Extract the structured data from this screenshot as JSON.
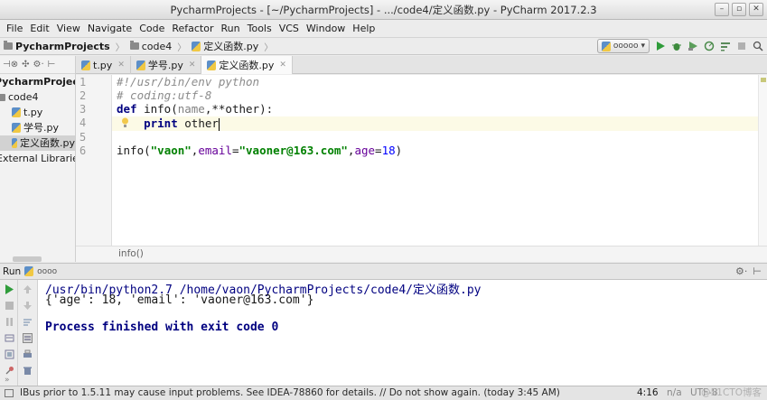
{
  "window": {
    "title": "PycharmProjects - [~/PycharmProjects] - .../code4/定义函数.py - PyCharm 2017.2.3"
  },
  "menu": [
    "File",
    "Edit",
    "View",
    "Navigate",
    "Code",
    "Refactor",
    "Run",
    "Tools",
    "VCS",
    "Window",
    "Help"
  ],
  "breadcrumb": {
    "project": "PycharmProjects",
    "folder": "code4",
    "file": "定义函数.py"
  },
  "run_config": {
    "label": "ooooo"
  },
  "sidebar": {
    "root": "PycharmProjects",
    "folder": "code4",
    "files": [
      "t.py",
      "学号.py",
      "定义函数.py"
    ],
    "external": "External Libraries"
  },
  "tabs": [
    "t.py",
    "学号.py",
    "定义函数.py"
  ],
  "editor": {
    "line_numbers": [
      "1",
      "2",
      "3",
      "4",
      "5",
      "6"
    ],
    "line1": "#!/usr/bin/env python",
    "line2": "# coding:utf-8",
    "line3": {
      "kw": "def",
      "name": " info(",
      "param": "name",
      "sep": ",**",
      "other": "other",
      "end": "):"
    },
    "line4": {
      "indent": "    ",
      "kw": "print",
      "space": " ",
      "var": "other"
    },
    "line6": {
      "fn": "info(",
      "s1": "\"vaon\"",
      "c1": ",",
      "k1": "email",
      "e1": "=",
      "s2": "\"vaoner@163.com\"",
      "c2": ",",
      "k2": "age",
      "e2": "=",
      "n": "18",
      "end": ")"
    },
    "footer_crumb": "info()"
  },
  "run_panel": {
    "title": "Run",
    "config": "oooo",
    "line1": "/usr/bin/python2.7 /home/vaon/PycharmProjects/code4/定义函数.py",
    "line2": "{'age': 18, 'email': 'vaoner@163.com'}",
    "line3": "Process finished with exit code 0"
  },
  "status": {
    "message": "IBus prior to 1.5.11 may cause input problems. See IDEA-78860 for details. // Do not show again. (today 3:45 AM)",
    "position": "4:16",
    "separator": "n/a",
    "encoding": "UTF-8",
    "watermark": "@51CTO博客"
  }
}
